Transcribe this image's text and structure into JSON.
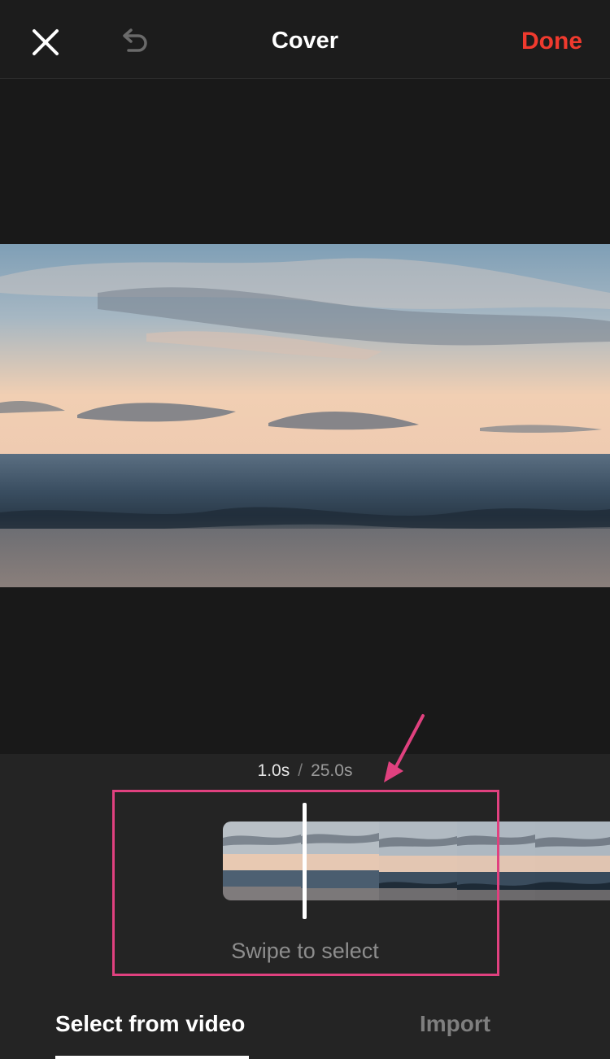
{
  "header": {
    "title": "Cover",
    "done_label": "Done",
    "close_icon": "close-icon",
    "undo_icon": "undo-icon",
    "accent_color": "#f03a2e"
  },
  "preview": {
    "image": "ocean sunset video frame"
  },
  "timeline": {
    "current_time": "1.0s",
    "separator": "/",
    "duration": "25.0s",
    "hint": "Swipe to select"
  },
  "tabs": [
    {
      "label": "Select from video",
      "active": true
    },
    {
      "label": "Import",
      "active": false
    }
  ],
  "annotation_color": "#e0417f"
}
